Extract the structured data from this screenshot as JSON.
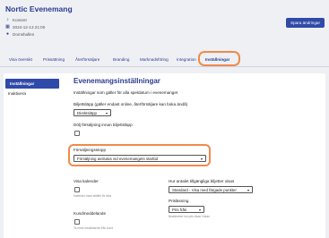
{
  "header": {
    "title": "Nortic Evenemang",
    "venue": "Konsert",
    "datetime": "2024-12-13 21:00",
    "location": "Domshallen",
    "sync_button": "Spara ändringar"
  },
  "tabs": [
    {
      "label": "Visa översikt"
    },
    {
      "label": "Prissättning"
    },
    {
      "label": "Återförsäljare"
    },
    {
      "label": "Branding"
    },
    {
      "label": "Marknadsföring"
    },
    {
      "label": "Integration"
    },
    {
      "label": "Inställningar",
      "active": true
    }
  ],
  "sidenav": {
    "items": [
      {
        "label": "Inställningar",
        "active": true
      },
      {
        "label": "Inaktivera"
      }
    ]
  },
  "settings": {
    "title": "Evenemangsinställningar",
    "intro": "Inställningar som gäller för alla speldatum i evenemanget",
    "ticket_release_label": "Biljettsläpp (gäller endast online, återförsäljare kan boka ändå)",
    "ticket_release_value": "Direktsläpp",
    "hide_price_label": "Dölj försäljning innan biljettsläpp",
    "sales_stop_label": "Försäljningsstopp",
    "sales_stop_value": "Försäljning avslutas vid evenemangets starttid",
    "show_calendar_label": "Visa kalender",
    "show_calendar_hint": "Kalender visas istället för lista",
    "customer_message_label": "Kundmeddelande",
    "customer_message_hint": "Ta emot meddelande från kund",
    "availability_label": "Hur antalet tillgängliga biljetter visas",
    "availability_value": "Standard - Visa med färgade punkter",
    "price_display_label": "Prisläsning",
    "price_display_value": "Pris från",
    "price_display_hint": "Bestämmer hur pris visas i listan"
  },
  "colors": {
    "brand": "#2b3b8f",
    "button": "#2f4aa8",
    "highlight": "#f08a4b"
  }
}
